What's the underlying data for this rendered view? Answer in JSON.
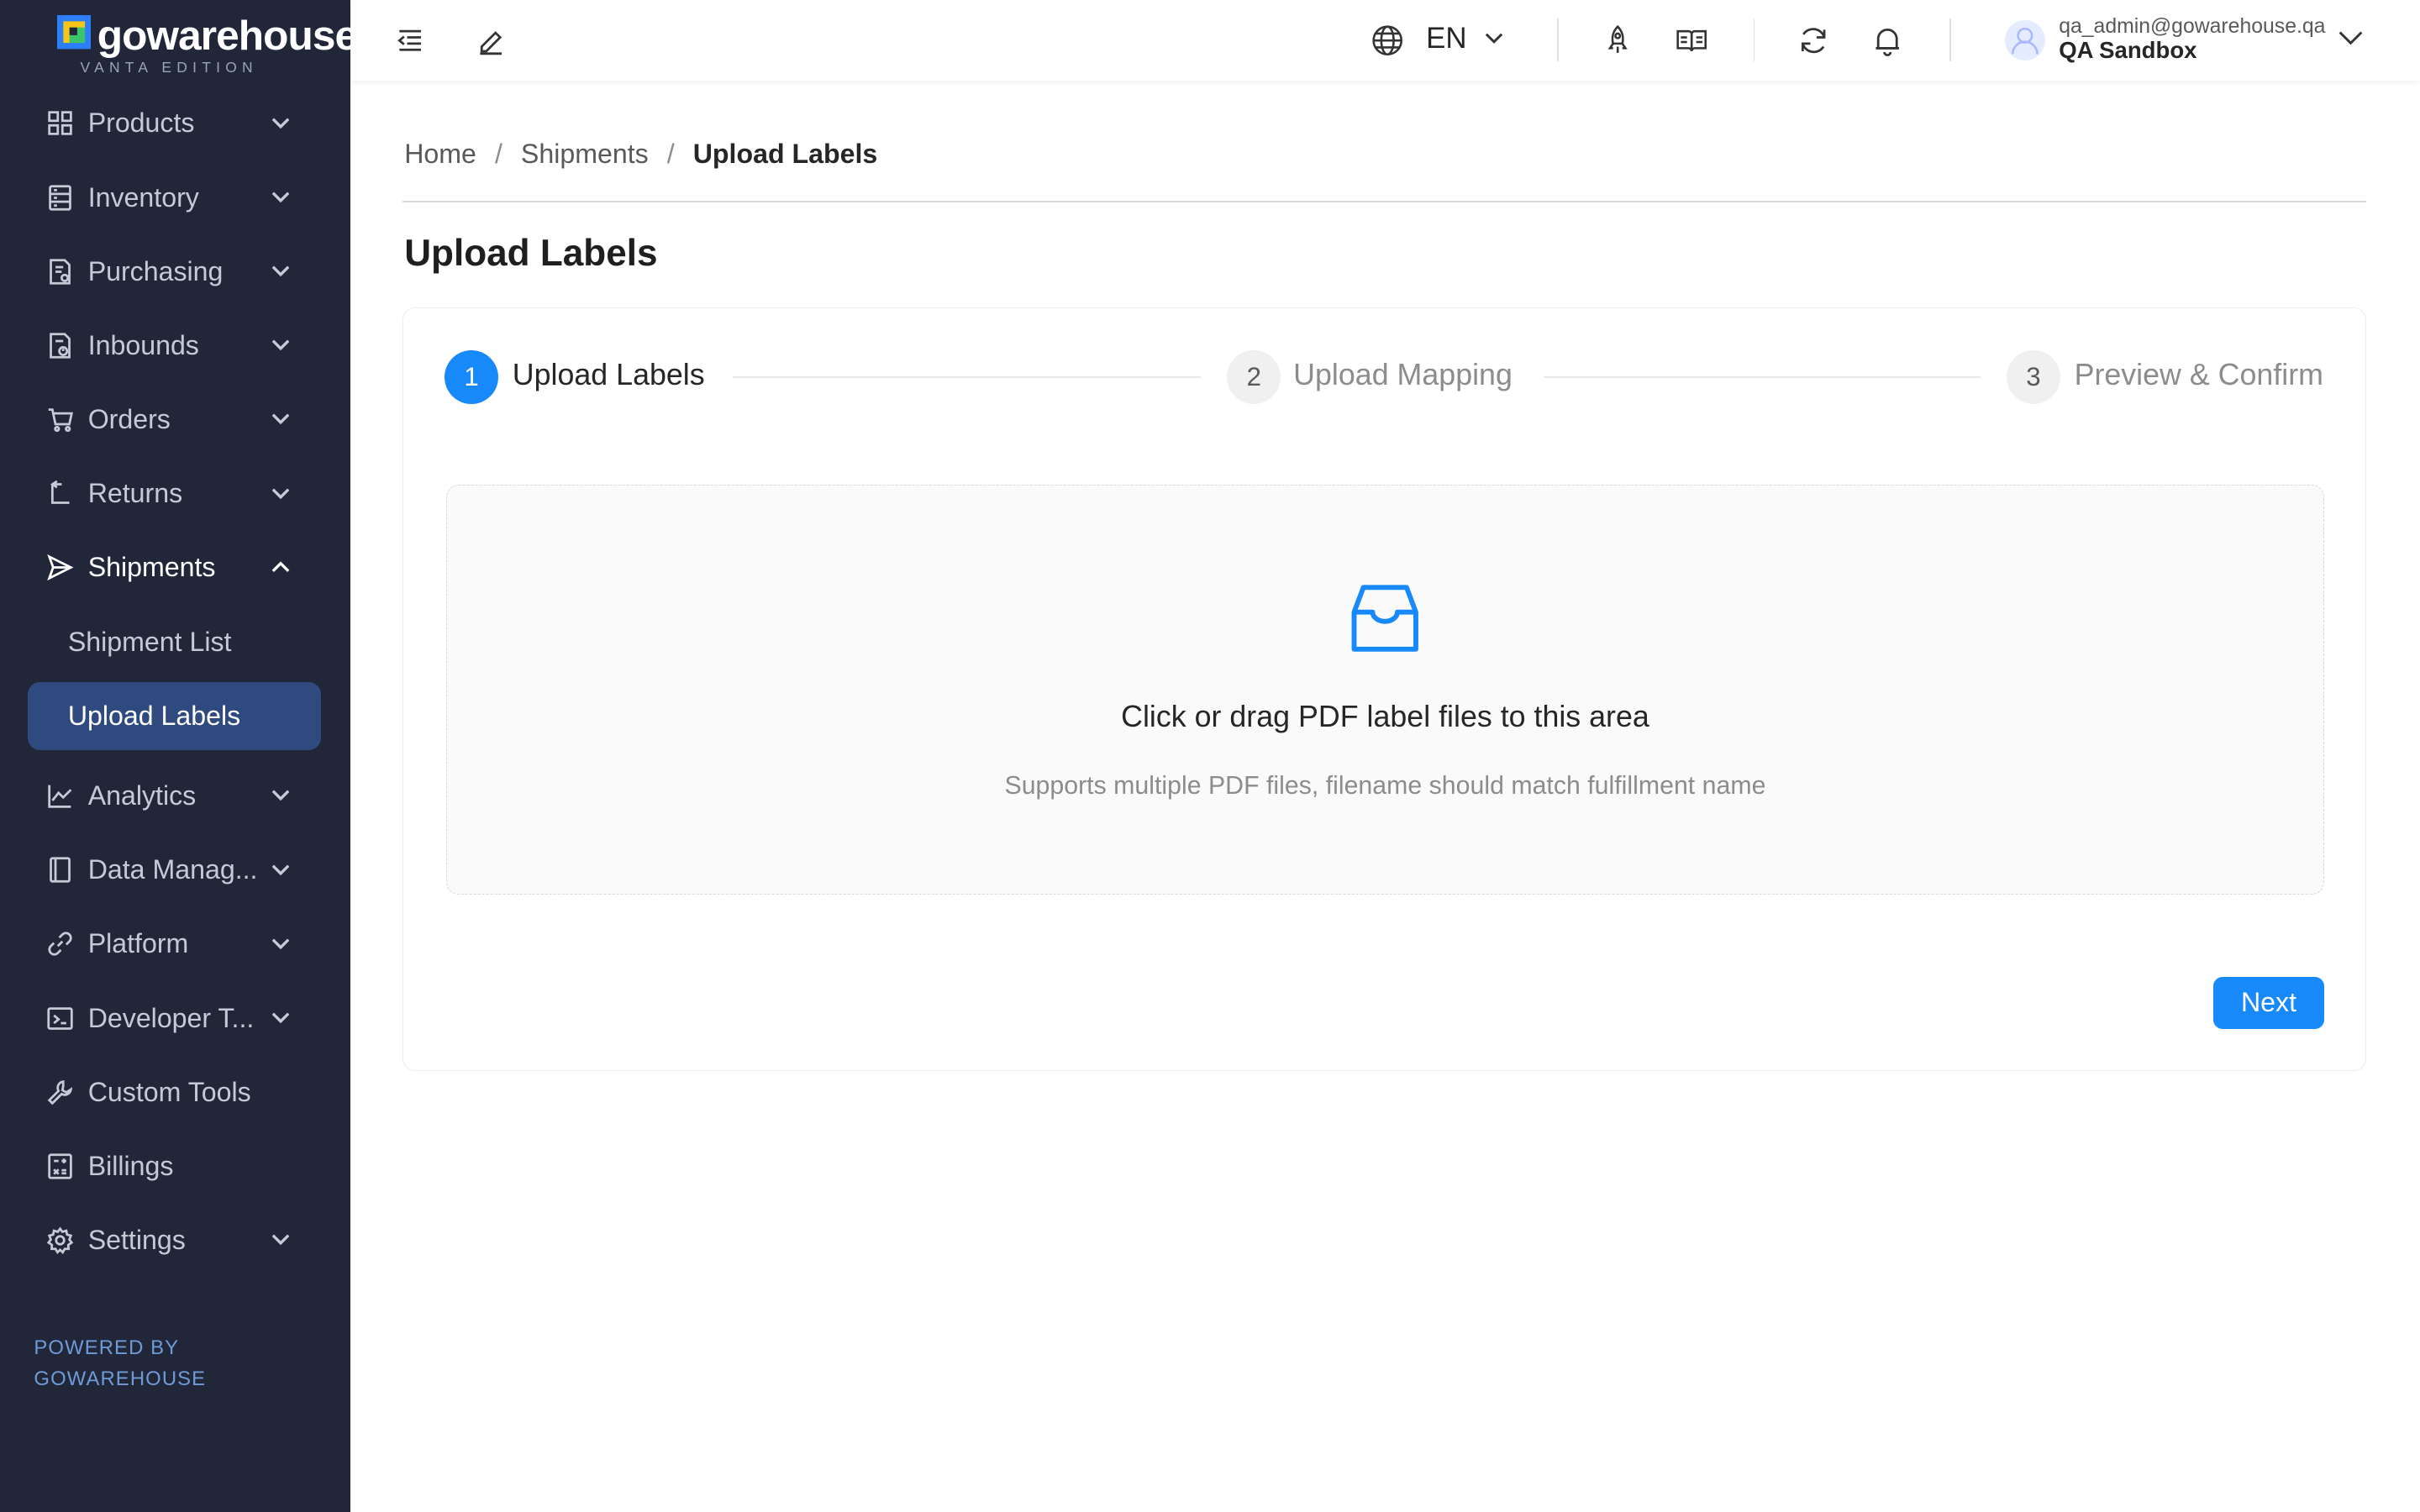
{
  "brand": {
    "name": "gowarehouse",
    "edition": "VANTA EDITION",
    "colors": {
      "sidebar_bg": "#212739",
      "accent": "#1789fb",
      "active_nav_bg": "#2f4a7f"
    }
  },
  "sidebar": {
    "items": [
      {
        "label": "Products",
        "icon": "grid-icon",
        "expandable": true
      },
      {
        "label": "Inventory",
        "icon": "inventory-icon",
        "expandable": true
      },
      {
        "label": "Purchasing",
        "icon": "purchasing-icon",
        "expandable": true
      },
      {
        "label": "Inbounds",
        "icon": "inbound-icon",
        "expandable": true
      },
      {
        "label": "Orders",
        "icon": "cart-icon",
        "expandable": true
      },
      {
        "label": "Returns",
        "icon": "return-icon",
        "expandable": true
      },
      {
        "label": "Shipments",
        "icon": "send-icon",
        "expandable": true,
        "open": true,
        "children": [
          {
            "label": "Shipment List"
          },
          {
            "label": "Upload Labels",
            "active": true
          }
        ]
      },
      {
        "label": "Analytics",
        "icon": "chart-icon",
        "expandable": true
      },
      {
        "label": "Data Manag...",
        "icon": "book-icon",
        "expandable": true
      },
      {
        "label": "Platform",
        "icon": "link-icon",
        "expandable": true
      },
      {
        "label": "Developer T...",
        "icon": "terminal-icon",
        "expandable": true
      },
      {
        "label": "Custom Tools",
        "icon": "tool-icon",
        "expandable": false
      },
      {
        "label": "Billings",
        "icon": "calculator-icon",
        "expandable": false
      },
      {
        "label": "Settings",
        "icon": "gear-icon",
        "expandable": true
      }
    ],
    "powered_line1": "POWERED BY",
    "powered_line2": "GOWAREHOUSE"
  },
  "header": {
    "language": "EN",
    "user_email": "qa_admin@gowarehouse.qa",
    "user_org": "QA Sandbox"
  },
  "breadcrumb": {
    "home": "Home",
    "parent": "Shipments",
    "current": "Upload Labels"
  },
  "page": {
    "title": "Upload Labels"
  },
  "steps": [
    {
      "number": "1",
      "title": "Upload Labels",
      "state": "active"
    },
    {
      "number": "2",
      "title": "Upload Mapping",
      "state": "wait"
    },
    {
      "number": "3",
      "title": "Preview & Confirm",
      "state": "wait"
    }
  ],
  "upload": {
    "main_text": "Click or drag PDF label files to this area",
    "hint_text": "Supports multiple PDF files, filename should match fulfillment name",
    "icon": "inbox-icon"
  },
  "actions": {
    "next_label": "Next"
  }
}
